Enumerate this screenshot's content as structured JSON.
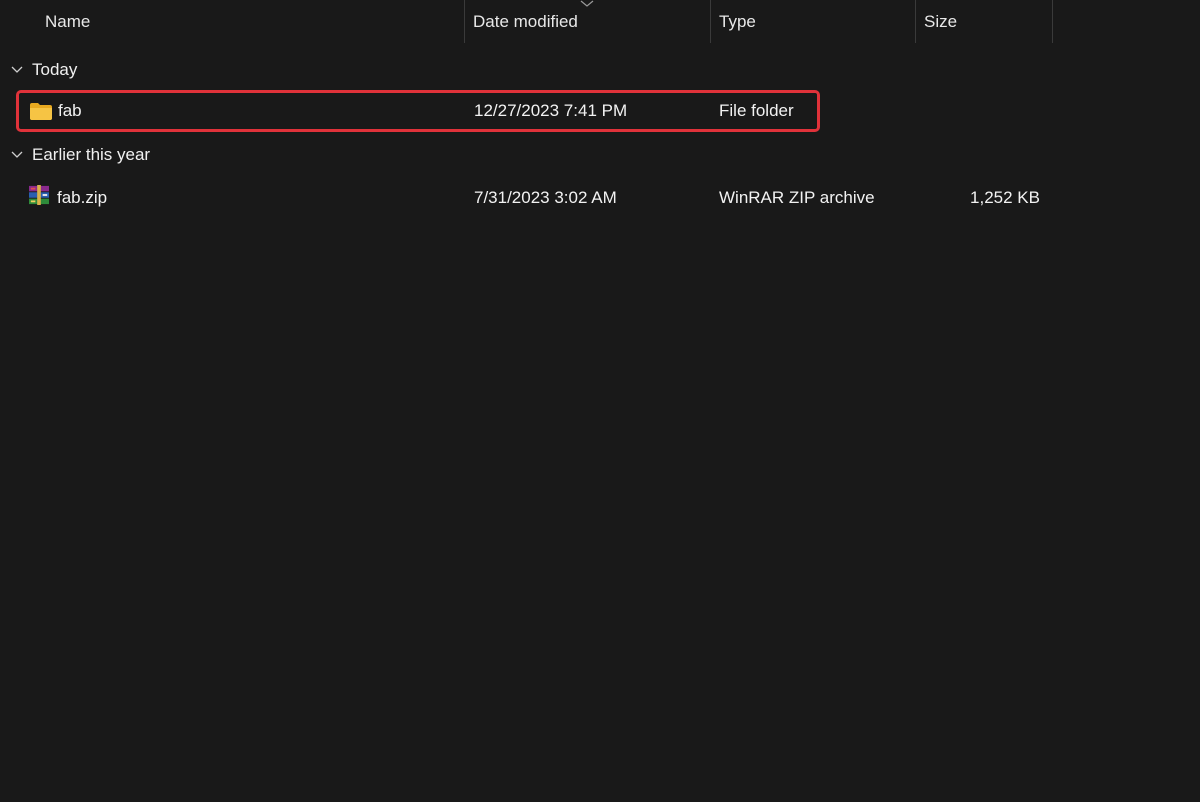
{
  "columns": {
    "name": "Name",
    "date_modified": "Date modified",
    "type": "Type",
    "size": "Size"
  },
  "groups": [
    {
      "label": "Today",
      "items": [
        {
          "name": "fab",
          "date_modified": "12/27/2023 7:41 PM",
          "type": "File folder",
          "size": "",
          "icon": "folder-icon",
          "highlighted": true
        }
      ]
    },
    {
      "label": "Earlier this year",
      "items": [
        {
          "name": "fab.zip",
          "date_modified": "7/31/2023 3:02 AM",
          "type": "WinRAR ZIP archive",
          "size": "1,252 KB",
          "icon": "winrar-archive-icon",
          "highlighted": false
        }
      ]
    }
  ],
  "colors": {
    "background": "#191919",
    "highlight_border": "#e0323a",
    "folder_yellow": "#f6c444"
  }
}
